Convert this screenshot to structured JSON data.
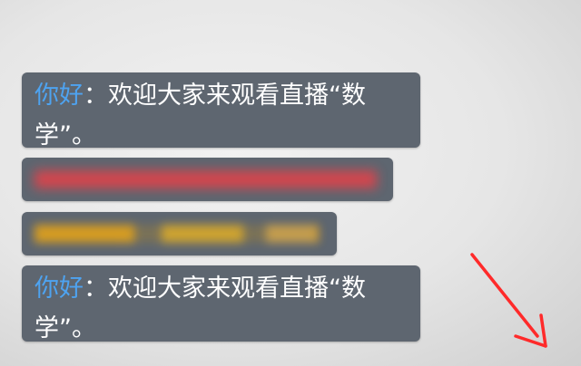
{
  "chat": {
    "messages": [
      {
        "user": "你好",
        "colon": "：",
        "text": "欢迎大家来观看直播“数学”。"
      },
      {
        "user": "",
        "colon": "",
        "text": ""
      },
      {
        "user": "",
        "colon": "",
        "text": ""
      },
      {
        "user": "你好",
        "colon": "：",
        "text": "欢迎大家来观看直播“数学”。"
      }
    ]
  },
  "colors": {
    "bubble": "#5e6670",
    "username": "#4ea3f0",
    "message_text": "#ffffff",
    "blurred_red": "#e0424a",
    "blurred_yellow": "#e2a21a",
    "annotation_arrow": "#ff2a2a"
  },
  "icons": {
    "annotation": "arrow-pointing-down-right"
  }
}
